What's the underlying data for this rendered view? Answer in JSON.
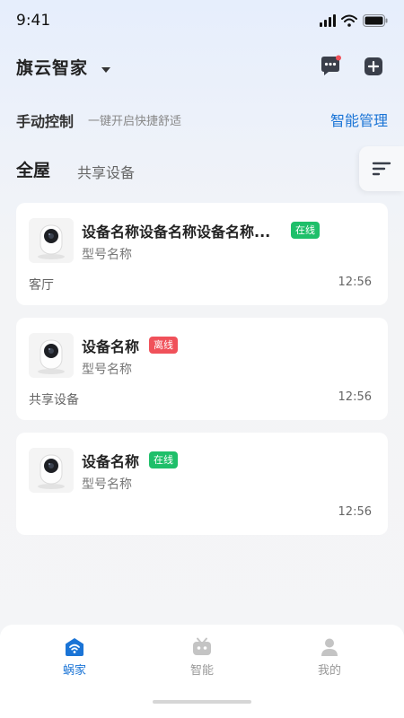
{
  "status_bar": {
    "time": "9:41"
  },
  "header": {
    "home_name": "旗云智家"
  },
  "control": {
    "title": "手动控制",
    "subtitle": "一键开启快捷舒适",
    "manage_label": "智能管理"
  },
  "tabs": [
    {
      "label": "全屋",
      "active": true
    },
    {
      "label": "共享设备",
      "active": false
    }
  ],
  "devices": [
    {
      "name": "设备名称设备名称设备名称...",
      "status": "在线",
      "status_color": "#1fbf6a",
      "model": "型号名称",
      "room": "客厅",
      "time": "12:56"
    },
    {
      "name": "设备名称",
      "status": "离线",
      "status_color": "#f0515a",
      "model": "型号名称",
      "room": "共享设备",
      "time": "12:56"
    },
    {
      "name": "设备名称",
      "status": "在线",
      "status_color": "#1fbf6a",
      "model": "型号名称",
      "room": "",
      "time": "12:56"
    }
  ],
  "bottom_nav": [
    {
      "label": "蜗家",
      "icon": "home-wifi-icon",
      "active": true
    },
    {
      "label": "智能",
      "icon": "robot-icon",
      "active": false
    },
    {
      "label": "我的",
      "icon": "person-icon",
      "active": false
    }
  ],
  "colors": {
    "accent": "#1a74d6",
    "online": "#1fbf6a",
    "offline": "#f0515a"
  }
}
